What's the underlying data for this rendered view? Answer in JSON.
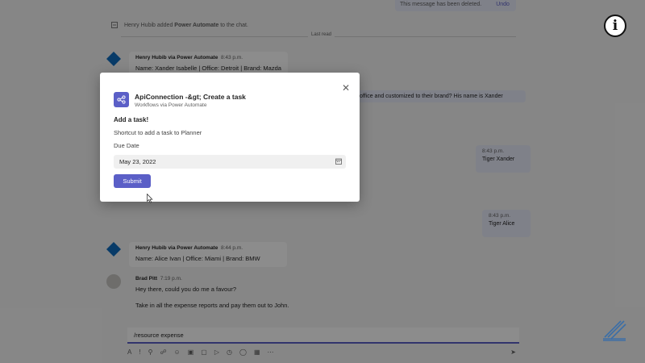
{
  "chat": {
    "deleted_notice": "This message has been deleted.",
    "undo_label": "Undo",
    "system_message": {
      "actor": "Henry Hubib",
      "verb": "added",
      "target": "Power Automate",
      "suffix": "to the chat."
    },
    "last_read": "Last read",
    "messages": [
      {
        "sender": "Henry Hubib via Power Automate",
        "time": "8:43 p.m.",
        "text": "Name: Xander Isabelle | Office: Detroit | Brand: Mazda"
      },
      {
        "sender": "Henry Hubib via Power Automate",
        "time": "8:44 p.m.",
        "text": "Name: Alice Ivan | Office: Miami | Brand: BMW"
      },
      {
        "sender": "Brad Pitt",
        "time": "7:19 p.m.",
        "text_1": "Hey there, could you do me a favour?",
        "text_2": "Take in all the expense reports and pay them out to John."
      }
    ],
    "right_snippets": {
      "r1": "office and customized to their brand? His name is Xander",
      "r2_time": "8:43 p.m.",
      "r2_text": "Tiger Xander",
      "r3_time": "8:43 p.m.",
      "r3_text": "Tiger Alice"
    },
    "compose_text": "/resource expense"
  },
  "modal": {
    "title": "ApiConnection -&gt; Create a task",
    "subtitle": "Workflows via Power Automate",
    "heading": "Add a task!",
    "description": "Shortcut to add a task to Planner",
    "due_date_label": "Due Date",
    "due_date_value": "May 23, 2022",
    "submit_label": "Submit"
  },
  "colors": {
    "accent": "#5b5fc7",
    "overlay": "rgba(0,0,0,0.45)"
  },
  "icons": [
    "close-icon",
    "connector-app-icon",
    "calendar-icon",
    "info-icon",
    "mouse-cursor-icon"
  ]
}
